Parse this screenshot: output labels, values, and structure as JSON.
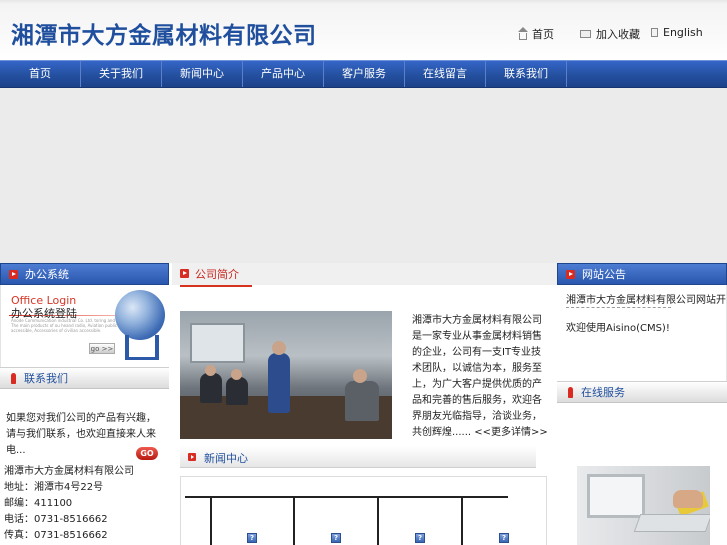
{
  "header": {
    "company_name": "湘潭市大方金属材料有限公司",
    "links": {
      "home": "首页",
      "favorite": "加入收藏",
      "english": "English"
    }
  },
  "nav": {
    "items": [
      "首页",
      "关于我们",
      "新闻中心",
      "产品中心",
      "客户服务",
      "在线留言",
      "联系我们"
    ]
  },
  "left": {
    "office_title": "办公系统",
    "office_login_en": "Office Login",
    "office_login_cn": "办公系统登陆",
    "office_fine_print": "Anode Communication industrial Co. Ltd. toring and sales. The main products of ou heand radio, Aviation public accessible, Accessories of civilian accessible.",
    "office_go": "go >>",
    "contact_title": "联系我们",
    "contact_text": "如果您对我们公司的产品有兴趣，请与我们联系，也欢迎直接来人来电...",
    "contact_go": "GO",
    "address_lines": [
      "湘潭市大方金属材料有限公司",
      "地址：湘潭市4号22号",
      "邮编：411100",
      "电话：0731-8516662",
      "传真：0731-8516662"
    ]
  },
  "middle": {
    "about_title": "公司简介",
    "about_text": "湘潭市大方金属材料有限公司是一家专业从事金属材料销售的企业，公司有一支IT专业技术团队，以诚信为本，服务至上，为广大客户提供优质的产品和完善的售后服务，欢迎各界朋友光临指导，洽谈业务，共创辉煌...... <<更多详情>>",
    "news_title": "新闻中心",
    "news_icon": "?"
  },
  "right": {
    "notice_title": "网站公告",
    "notice_line1": "湘潭市大方金属材料有限公司网站开通了 ...",
    "notice_line2": "欢迎使用Aisino(CMS)!",
    "service_title": "在线服务"
  },
  "colors": {
    "brand_blue": "#1f4f9d",
    "nav_blue": "#24509f",
    "accent_red": "#d92b22"
  }
}
